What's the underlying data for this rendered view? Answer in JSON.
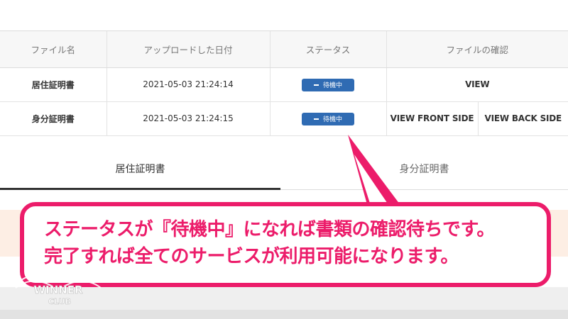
{
  "table": {
    "headers": [
      "ファイル名",
      "アップロードした日付",
      "ステータス",
      "ファイルの確認"
    ],
    "rows": [
      {
        "name": "居住証明書",
        "date": "2021-05-03 21:24:14",
        "status": "待機中",
        "view": "VIEW"
      },
      {
        "name": "身分証明書",
        "date": "2021-05-03 21:24:15",
        "status": "待機中",
        "view_front": "VIEW FRONT SIDE",
        "view_back": "VIEW BACK SIDE"
      }
    ]
  },
  "tabs": [
    "居住証明書",
    "身分証明書"
  ],
  "callout": {
    "line1": "ステータスが『待機中』になれば書類の確認待ちです。",
    "line2": "完了すれば全てのサービスが利用可能になります。"
  },
  "logo": {
    "text_main": "WINNER",
    "text_sub": "CLUB"
  },
  "colors": {
    "accent": "#ec1c6a",
    "badge": "#2f6bb3",
    "view_link": "#ea5a1a"
  },
  "icons": {
    "badge_icon": "minus-icon"
  }
}
